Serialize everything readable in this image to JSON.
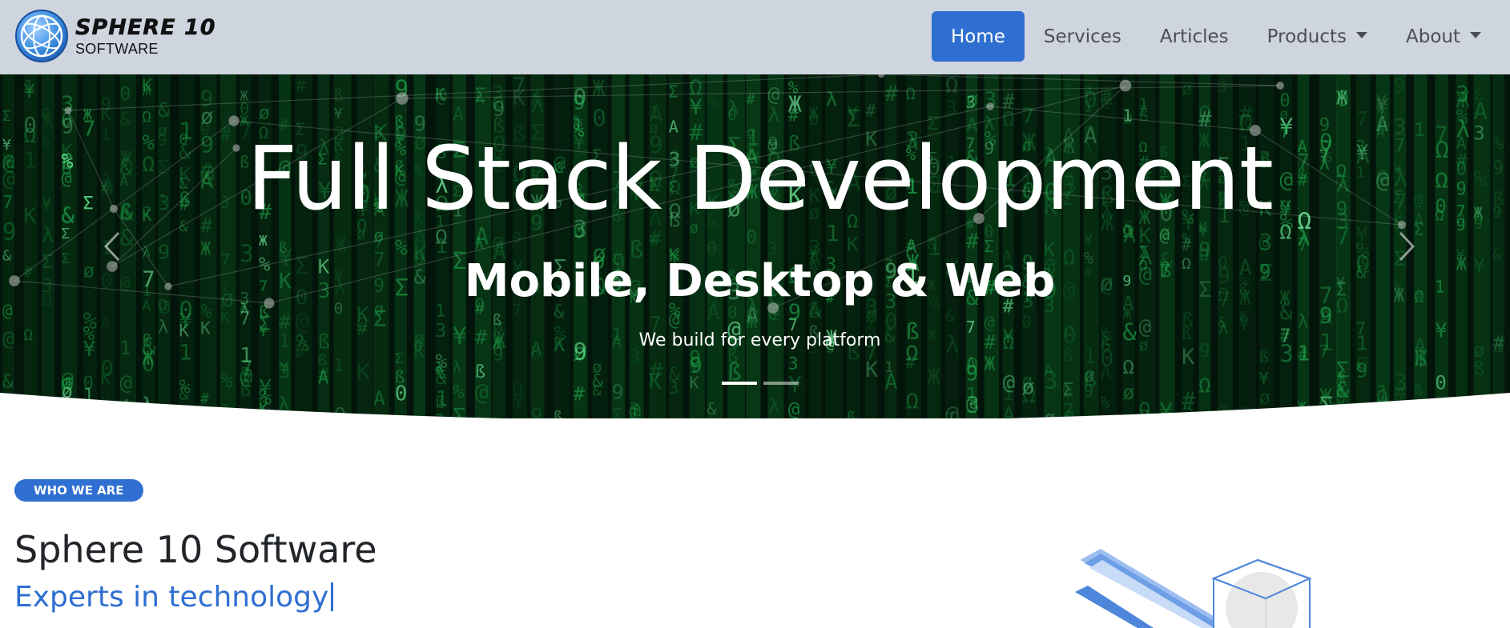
{
  "brand": {
    "name": "SPHERE 10",
    "subtitle": "SOFTWARE"
  },
  "nav": {
    "items": [
      {
        "label": "Home",
        "active": true,
        "dropdown": false
      },
      {
        "label": "Services",
        "active": false,
        "dropdown": false
      },
      {
        "label": "Articles",
        "active": false,
        "dropdown": false
      },
      {
        "label": "Products",
        "active": false,
        "dropdown": true
      },
      {
        "label": "About",
        "active": false,
        "dropdown": true
      }
    ]
  },
  "hero": {
    "title": "Full Stack Development",
    "subtitle": "Mobile, Desktop & Web",
    "tagline": "We build for every platform",
    "slide_count": 2,
    "active_slide": 1
  },
  "content": {
    "badge": "WHO WE ARE",
    "title": "Sphere 10 Software",
    "tagline": "Experts in technology"
  },
  "colors": {
    "accent": "#2f6fd1",
    "navbar_bg": "#cfd5de",
    "hero_bg": "#03140a",
    "matrix_green": "#1fa64a"
  },
  "icons": {
    "logo": "sphere-logo-icon",
    "prev": "chevron-left-icon",
    "next": "chevron-right-icon",
    "dropdown": "caret-down-icon"
  }
}
